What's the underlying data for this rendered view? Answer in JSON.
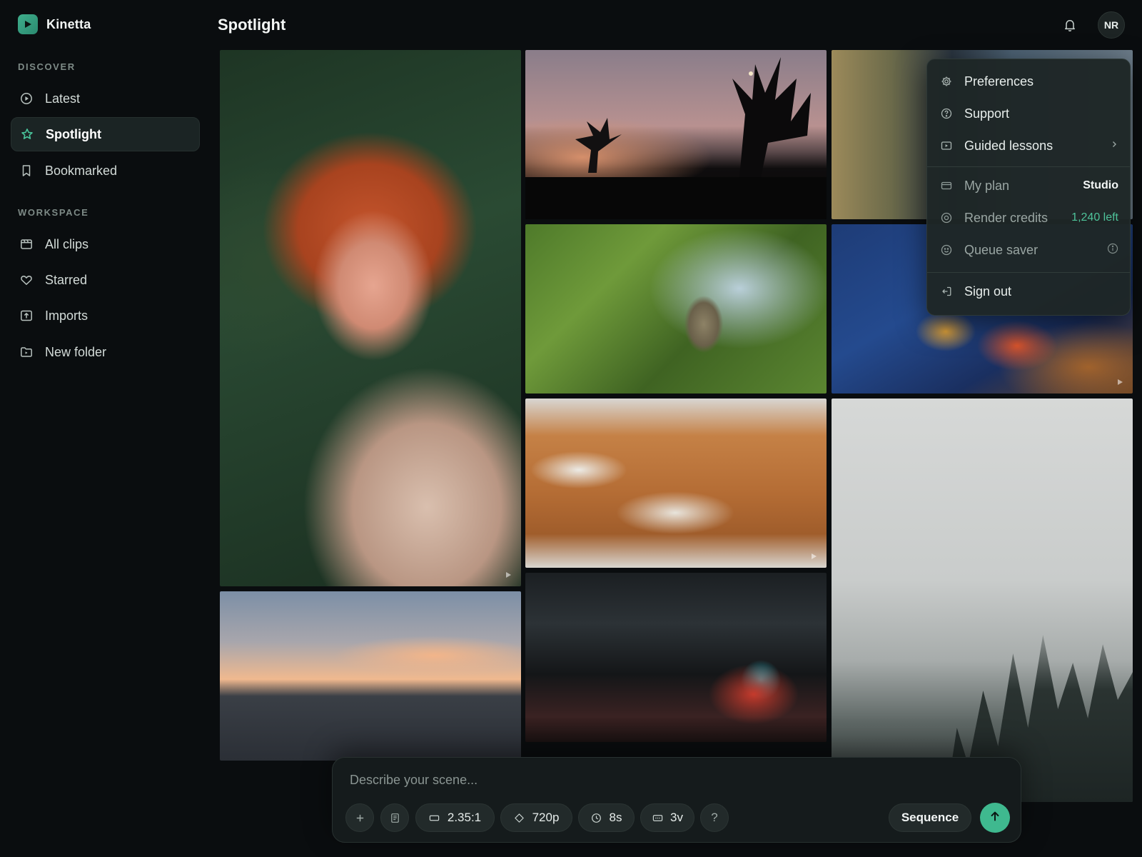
{
  "app": {
    "name": "Kinetta",
    "accent": "#3fb98f"
  },
  "sidebar": {
    "discover_label": "DISCOVER",
    "workspace_label": "WORKSPACE",
    "discover_items": [
      {
        "label": "Latest",
        "icon": "play-circle-icon"
      },
      {
        "label": "Spotlight",
        "icon": "star-icon",
        "active": true
      },
      {
        "label": "Bookmarked",
        "icon": "bookmark-icon"
      }
    ],
    "workspace_items": [
      {
        "label": "All clips",
        "icon": "clapper-icon"
      },
      {
        "label": "Starred",
        "icon": "heart-icon"
      },
      {
        "label": "Imports",
        "icon": "upload-icon"
      },
      {
        "label": "New folder",
        "icon": "folder-icon"
      }
    ]
  },
  "header": {
    "title": "Spotlight",
    "avatar_initials": "NR"
  },
  "menu": {
    "preferences": "Preferences",
    "support": "Support",
    "guided_lessons": "Guided lessons",
    "my_plan": "My plan",
    "my_plan_value": "Studio",
    "render_credits": "Render credits",
    "render_credits_value": "1,240 left",
    "queue_saver": "Queue saver",
    "sign_out": "Sign out"
  },
  "composer": {
    "placeholder": "Describe your scene...",
    "aspect": "2.35:1",
    "resolution": "720p",
    "duration": "8s",
    "variations": "3v",
    "help": "?",
    "sequence_label": "Sequence"
  }
}
